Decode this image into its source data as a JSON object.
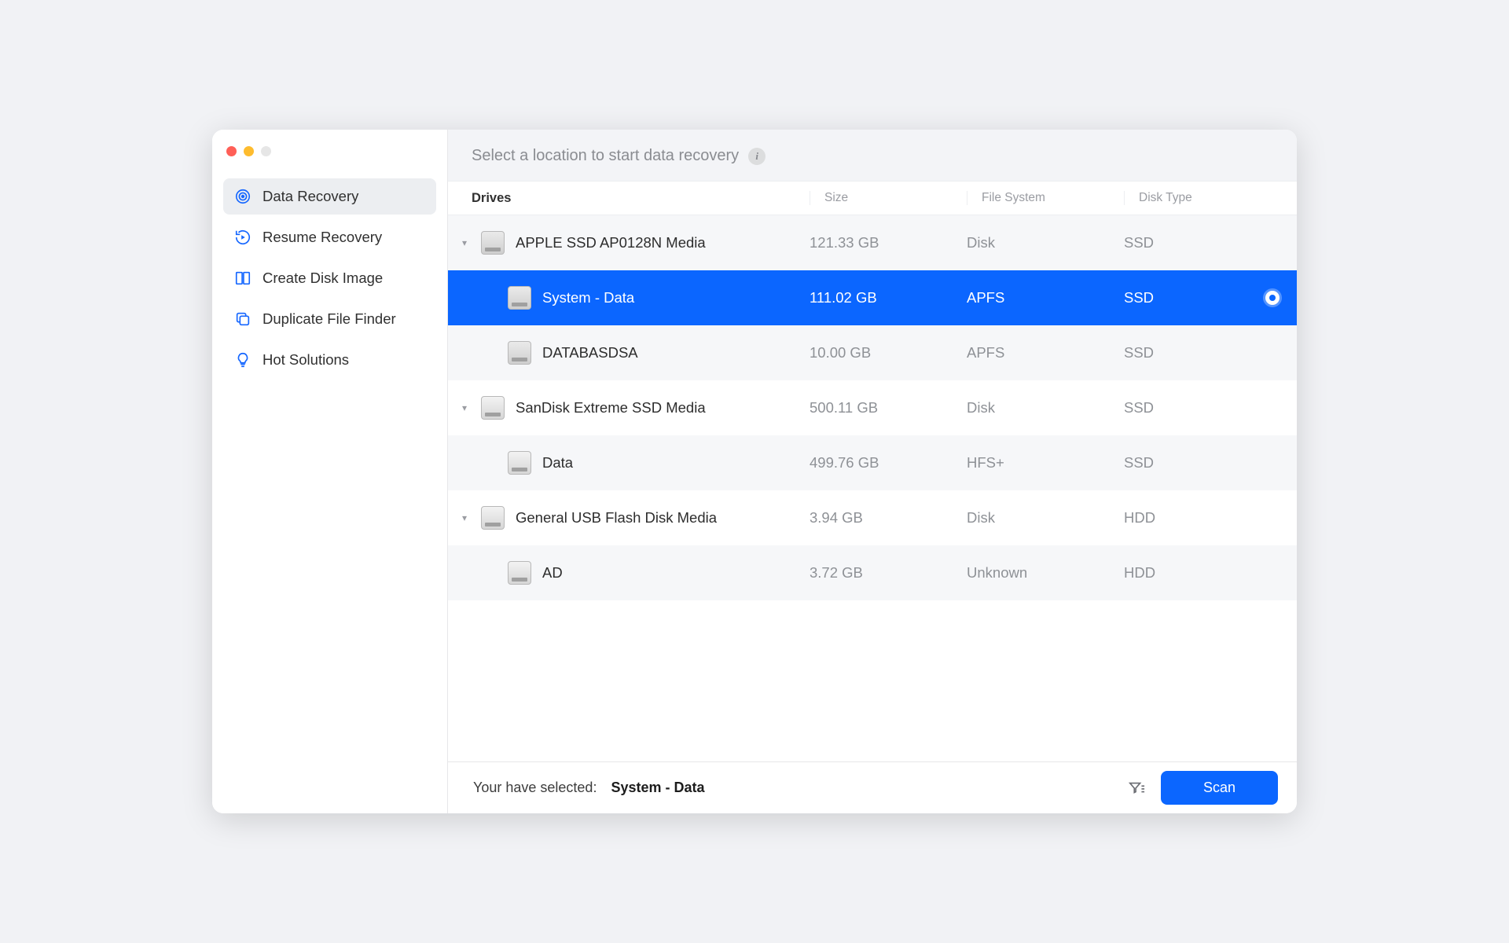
{
  "sidebar": {
    "items": [
      {
        "label": "Data Recovery",
        "icon": "target"
      },
      {
        "label": "Resume Recovery",
        "icon": "resume"
      },
      {
        "label": "Create Disk Image",
        "icon": "diskimage"
      },
      {
        "label": "Duplicate File Finder",
        "icon": "duplicate"
      },
      {
        "label": "Hot Solutions",
        "icon": "bulb"
      }
    ],
    "active_index": 0
  },
  "header": {
    "title": "Select a location to start data recovery"
  },
  "columns": {
    "c1": "Drives",
    "c2": "Size",
    "c3": "File System",
    "c4": "Disk Type"
  },
  "rows": [
    {
      "expandable": true,
      "indent": 0,
      "icon": "internal",
      "name": "APPLE SSD AP0128N Media",
      "size": "121.33 GB",
      "fs": "Disk",
      "type": "SSD",
      "alt": true,
      "selected": false
    },
    {
      "expandable": false,
      "indent": 1,
      "icon": "internal",
      "name": "System - Data",
      "size": "111.02 GB",
      "fs": "APFS",
      "type": "SSD",
      "alt": false,
      "selected": true
    },
    {
      "expandable": false,
      "indent": 1,
      "icon": "internal",
      "name": "DATABASDSA",
      "size": "10.00 GB",
      "fs": "APFS",
      "type": "SSD",
      "alt": true,
      "selected": false
    },
    {
      "expandable": true,
      "indent": 0,
      "icon": "external",
      "name": "SanDisk Extreme SSD Media",
      "size": "500.11 GB",
      "fs": "Disk",
      "type": "SSD",
      "alt": false,
      "selected": false
    },
    {
      "expandable": false,
      "indent": 1,
      "icon": "external",
      "name": "Data",
      "size": "499.76 GB",
      "fs": "HFS+",
      "type": "SSD",
      "alt": true,
      "selected": false
    },
    {
      "expandable": true,
      "indent": 0,
      "icon": "external",
      "name": "General USB Flash Disk Media",
      "size": "3.94 GB",
      "fs": "Disk",
      "type": "HDD",
      "alt": false,
      "selected": false
    },
    {
      "expandable": false,
      "indent": 1,
      "icon": "external",
      "name": "AD",
      "size": "3.72 GB",
      "fs": "Unknown",
      "type": "HDD",
      "alt": true,
      "selected": false
    }
  ],
  "footer": {
    "selected_label": "Your have selected:",
    "selected_value": "System - Data",
    "scan_label": "Scan"
  }
}
